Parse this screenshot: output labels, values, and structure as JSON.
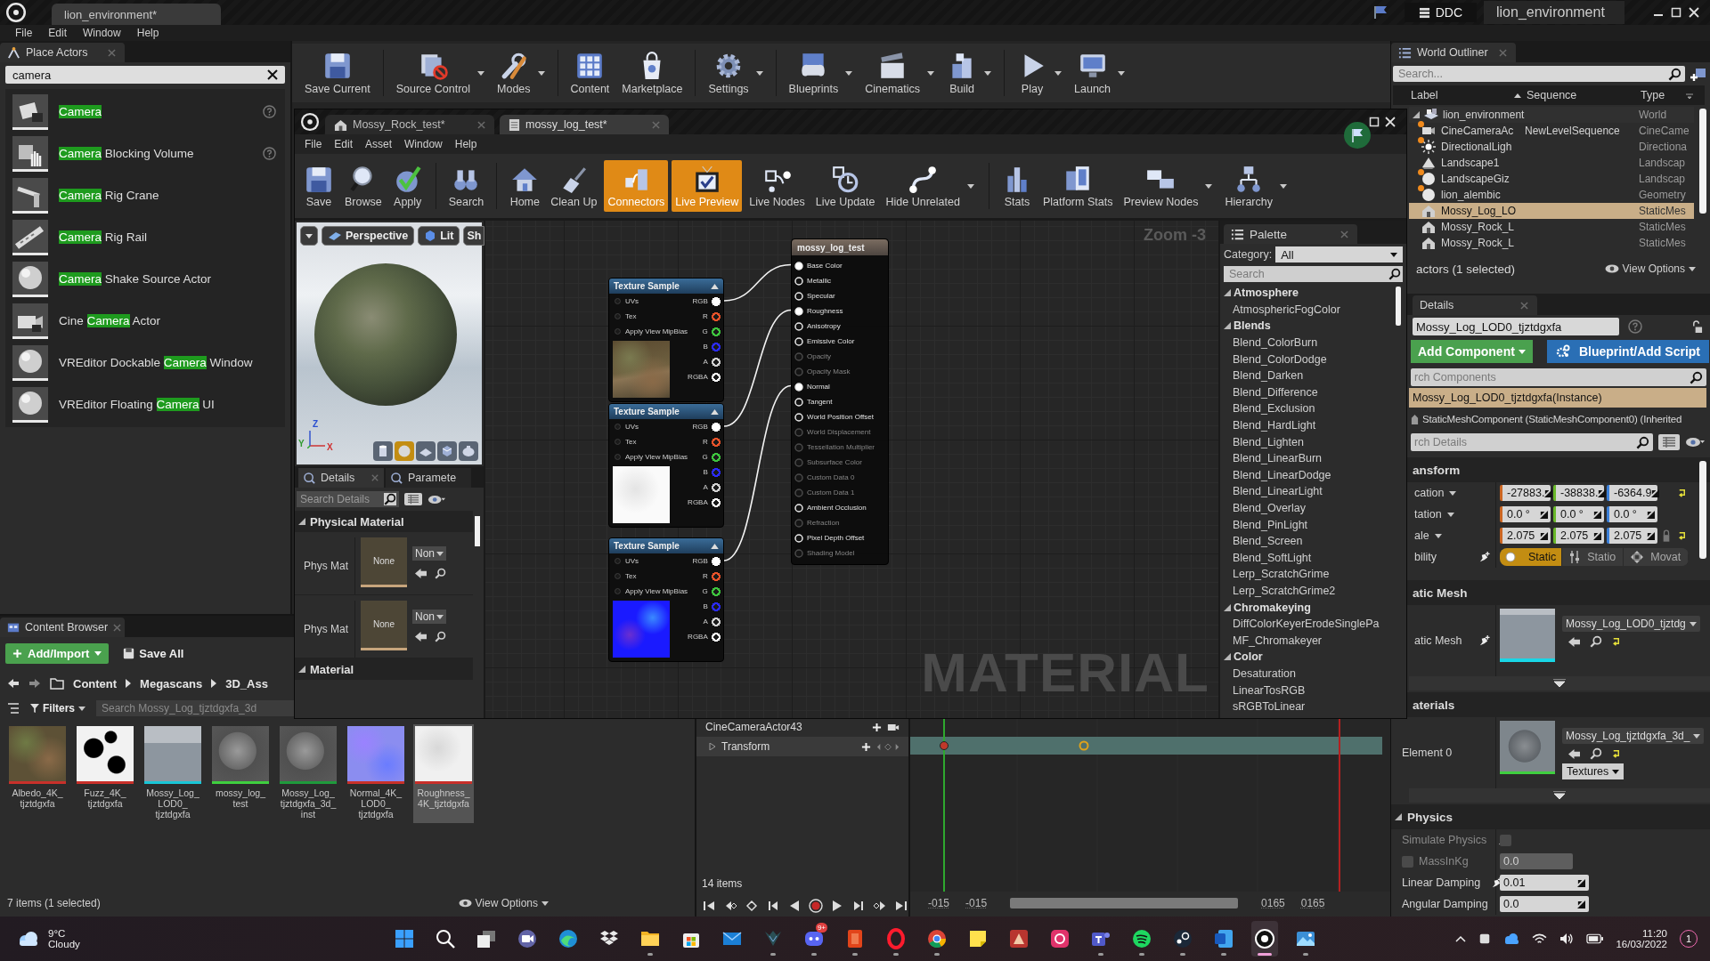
{
  "title_bar": {
    "tab": "lion_environment*",
    "cache": "DDC",
    "project": "lion_environment"
  },
  "menu": [
    "File",
    "Edit",
    "Window",
    "Help"
  ],
  "place_actors": {
    "tab": "Place Actors",
    "search": "camera",
    "items": [
      {
        "match": "Camera",
        "help": true
      },
      {
        "match": "Camera",
        "after": " Blocking Volume",
        "help": true
      },
      {
        "match": "Camera",
        "after": " Rig Crane",
        "help": false
      },
      {
        "match": "Camera",
        "after": " Rig Rail",
        "help": false
      },
      {
        "match": "Camera",
        "after": " Shake Source Actor",
        "help": false
      },
      {
        "before": "Cine ",
        "match": "Camera",
        "after": " Actor",
        "help": false
      },
      {
        "before": "VREditor Dockable ",
        "match": "Camera",
        "after": " Window",
        "help": false
      },
      {
        "before": "VREditor Floating ",
        "match": "Camera",
        "after": " UI",
        "help": false
      }
    ]
  },
  "toolbar": [
    {
      "label": "Save Current",
      "dropdown": false
    },
    {
      "label": "Source Control",
      "dropdown": true
    },
    {
      "label": "Modes",
      "dropdown": true
    },
    {
      "label": "Content",
      "dropdown": false
    },
    {
      "label": "Marketplace",
      "dropdown": false
    },
    {
      "label": "Settings",
      "dropdown": true
    },
    {
      "label": "Blueprints",
      "dropdown": true
    },
    {
      "label": "Cinematics",
      "dropdown": true
    },
    {
      "label": "Build",
      "dropdown": true
    },
    {
      "label": "Play",
      "dropdown": true
    },
    {
      "label": "Launch",
      "dropdown": true
    }
  ],
  "material_editor": {
    "tabs": [
      {
        "label": "Mossy_Rock_test*",
        "selected": false
      },
      {
        "label": "mossy_log_test*",
        "selected": true
      }
    ],
    "menu": [
      "File",
      "Edit",
      "Asset",
      "Window",
      "Help"
    ],
    "toolbar": [
      {
        "label": "Save",
        "on": false,
        "dropdown": false
      },
      {
        "label": "Browse",
        "on": false,
        "dropdown": false
      },
      {
        "label": "Apply",
        "on": false,
        "dropdown": false
      },
      {
        "label": "Search",
        "on": false,
        "dropdown": false
      },
      {
        "label": "Home",
        "on": false,
        "dropdown": false
      },
      {
        "label": "Clean Up",
        "on": false,
        "dropdown": false
      },
      {
        "label": "Connectors",
        "on": true,
        "dropdown": false
      },
      {
        "label": "Live Preview",
        "on": true,
        "dropdown": false
      },
      {
        "label": "Live Nodes",
        "on": false,
        "dropdown": false
      },
      {
        "label": "Live Update",
        "on": false,
        "dropdown": false
      },
      {
        "label": "Hide Unrelated",
        "on": false,
        "dropdown": true
      },
      {
        "label": "Stats",
        "on": false,
        "dropdown": false
      },
      {
        "label": "Platform Stats",
        "on": false,
        "dropdown": false
      },
      {
        "label": "Preview Nodes",
        "on": false,
        "dropdown": true
      },
      {
        "label": "Hierarchy",
        "on": false,
        "dropdown": true
      }
    ],
    "viewport": {
      "view": "Perspective",
      "lighting": "Lit",
      "show": "Sh",
      "axis_labels": [
        "Z",
        "Y",
        "X"
      ],
      "shapes": [
        {
          "selected": false
        },
        {
          "selected": true
        },
        {
          "selected": false
        },
        {
          "selected": false
        },
        {
          "selected": false
        }
      ]
    },
    "details": {
      "tabs": [
        {
          "label": "Details",
          "selected": true
        },
        {
          "label": "Paramete",
          "selected": false
        }
      ],
      "search": {
        "placeholder": "Search Details"
      },
      "sections": [
        {
          "title": "Physical Material",
          "expanded": true,
          "rows": [
            {
              "label": "Phys Mat",
              "thumb": "None",
              "value": "Non"
            },
            {
              "label": "Phys Mat",
              "thumb": "None",
              "value": "Non"
            }
          ]
        },
        {
          "title": "Material",
          "expanded": true
        }
      ]
    },
    "graph": {
      "zoom": "Zoom -3",
      "label": "MATERIAL"
    },
    "texture_nodes": [
      {
        "title": "Texture Sample",
        "inputs": [
          "UVs",
          "Tex",
          "Apply View MipBias"
        ],
        "outputs": [
          {
            "label": "RGB",
            "color": "#ffffff",
            "connected": true
          },
          {
            "label": "R",
            "color": "#e8532a",
            "connected": false
          },
          {
            "label": "G",
            "color": "#3ec43e",
            "connected": false
          },
          {
            "label": "B",
            "color": "#2b2bff",
            "connected": false
          },
          {
            "label": "A",
            "color": "#d0d0d0",
            "connected": false
          },
          {
            "label": "RGBA",
            "color": "#ffffff",
            "connected": false
          }
        ]
      },
      {
        "title": "Texture Sample",
        "inputs": [
          "UVs",
          "Tex",
          "Apply View MipBias"
        ],
        "outputs": [
          {
            "label": "RGB",
            "color": "#ffffff",
            "connected": true
          },
          {
            "label": "R",
            "color": "#e8532a",
            "connected": false
          },
          {
            "label": "G",
            "color": "#3ec43e",
            "connected": false
          },
          {
            "label": "B",
            "color": "#2b2bff",
            "connected": false
          },
          {
            "label": "A",
            "color": "#d0d0d0",
            "connected": false
          },
          {
            "label": "RGBA",
            "color": "#ffffff",
            "connected": false
          }
        ]
      },
      {
        "title": "Texture Sample",
        "inputs": [
          "UVs",
          "Tex",
          "Apply View MipBias"
        ],
        "outputs": [
          {
            "label": "RGB",
            "color": "#ffffff",
            "connected": true
          },
          {
            "label": "R",
            "color": "#e8532a",
            "connected": false
          },
          {
            "label": "G",
            "color": "#3ec43e",
            "connected": false
          },
          {
            "label": "B",
            "color": "#2b2bff",
            "connected": false
          },
          {
            "label": "A",
            "color": "#d0d0d0",
            "connected": false
          },
          {
            "label": "RGBA",
            "color": "#ffffff",
            "connected": false
          }
        ]
      }
    ],
    "output_node": {
      "title": "mossy_log_test",
      "pins": [
        {
          "label": "Base Color",
          "connected": true,
          "disabled": false
        },
        {
          "label": "Metallic",
          "connected": false,
          "disabled": false
        },
        {
          "label": "Specular",
          "connected": false,
          "disabled": false
        },
        {
          "label": "Roughness",
          "connected": true,
          "disabled": false
        },
        {
          "label": "Anisotropy",
          "connected": false,
          "disabled": false
        },
        {
          "label": "Emissive Color",
          "connected": false,
          "disabled": false
        },
        {
          "label": "Opacity",
          "connected": false,
          "disabled": true
        },
        {
          "label": "Opacity Mask",
          "connected": false,
          "disabled": true
        },
        {
          "label": "Normal",
          "connected": true,
          "disabled": false
        },
        {
          "label": "Tangent",
          "connected": false,
          "disabled": false
        },
        {
          "label": "World Position Offset",
          "connected": false,
          "disabled": false
        },
        {
          "label": "World Displacement",
          "connected": false,
          "disabled": true
        },
        {
          "label": "Tessellation Multiplier",
          "connected": false,
          "disabled": true
        },
        {
          "label": "Subsurface Color",
          "connected": false,
          "disabled": true
        },
        {
          "label": "Custom Data 0",
          "connected": false,
          "disabled": true
        },
        {
          "label": "Custom Data 1",
          "connected": false,
          "disabled": true
        },
        {
          "label": "Ambient Occlusion",
          "connected": false,
          "disabled": false
        },
        {
          "label": "Refraction",
          "connected": false,
          "disabled": true
        },
        {
          "label": "Pixel Depth Offset",
          "connected": false,
          "disabled": false
        },
        {
          "label": "Shading Model",
          "connected": false,
          "disabled": true
        }
      ]
    },
    "palette": {
      "tab": "Palette",
      "category_label": "Category:",
      "category": "All",
      "search": {
        "placeholder": "Search"
      },
      "groups": [
        {
          "label": "Atmosphere",
          "expanded": true,
          "children": [
            {
              "label": "AtmosphericFogColor"
            }
          ]
        },
        {
          "label": "Blends",
          "expanded": true,
          "children": [
            {
              "label": "Blend_ColorBurn"
            },
            {
              "label": "Blend_ColorDodge"
            },
            {
              "label": "Blend_Darken"
            },
            {
              "label": "Blend_Difference"
            },
            {
              "label": "Blend_Exclusion"
            },
            {
              "label": "Blend_HardLight"
            },
            {
              "label": "Blend_Lighten"
            },
            {
              "label": "Blend_LinearBurn"
            },
            {
              "label": "Blend_LinearDodge"
            },
            {
              "label": "Blend_LinearLight"
            },
            {
              "label": "Blend_Overlay"
            },
            {
              "label": "Blend_PinLight"
            },
            {
              "label": "Blend_Screen"
            },
            {
              "label": "Blend_SoftLight"
            },
            {
              "label": "Lerp_ScratchGrime"
            },
            {
              "label": "Lerp_ScratchGrime2"
            }
          ]
        },
        {
          "label": "Chromakeying",
          "expanded": true,
          "children": [
            {
              "label": "DiffColorKeyerErodeSinglePa"
            },
            {
              "label": "MF_Chromakeyer"
            }
          ]
        },
        {
          "label": "Color",
          "expanded": true,
          "children": [
            {
              "label": "Desaturation"
            },
            {
              "label": "LinearTosRGB"
            },
            {
              "label": "sRGBToLinear"
            }
          ]
        }
      ]
    }
  },
  "world_outliner": {
    "tab": "World Outliner",
    "search": {
      "placeholder": "Search..."
    },
    "columns": [
      "Label",
      "Sequence",
      "Type"
    ],
    "rows": [
      {
        "label": "lion_environment",
        "type": "World",
        "selected": false,
        "marked": false,
        "expanded": true,
        "children": [
          {
            "label": "CineCameraAc",
            "sequence": "NewLevelSequence",
            "type": "CineCame",
            "selected": false,
            "marked": true
          },
          {
            "label": "DirectionalLigh",
            "type": "Directiona",
            "selected": false,
            "marked": true
          },
          {
            "label": "Landscape1",
            "type": "Landscap",
            "selected": false,
            "marked": false
          },
          {
            "label": "LandscapeGiz",
            "type": "Landscap",
            "selected": false,
            "marked": true
          },
          {
            "label": "lion_alembic",
            "type": "Geometry",
            "selected": false,
            "marked": true
          },
          {
            "label": "Mossy_Log_LO",
            "type": "StaticMes",
            "selected": true,
            "marked": false
          },
          {
            "label": "Mossy_Rock_L",
            "type": "StaticMes",
            "selected": false,
            "marked": false
          },
          {
            "label": "Mossy_Rock_L",
            "type": "StaticMes",
            "selected": false,
            "marked": false
          }
        ]
      }
    ],
    "footer": "actors (1 selected)",
    "view_options": "View Options"
  },
  "details": {
    "tab": "Details",
    "name": "Mossy_Log_LOD0_tjztdgxfa",
    "add_component": "Add Component",
    "blueprint": "Blueprint/Add Script",
    "component_search": {
      "placeholder": "rch Components"
    },
    "components": [
      {
        "label": "Mossy_Log_LOD0_tjztdgxfa(Instance)",
        "selected": true
      },
      {
        "label": "StaticMeshComponent (StaticMeshComponent0) (Inherited",
        "selected": false
      }
    ],
    "detail_search": {
      "placeholder": "rch Details"
    },
    "transform": {
      "title": "ansform",
      "rows": [
        {
          "label": "cation",
          "values": [
            "-27883.",
            "-38838.",
            "-6364.9"
          ],
          "lock": false,
          "reset": true
        },
        {
          "label": "tation",
          "values": [
            "0.0 °",
            "0.0 °",
            "0.0 °"
          ],
          "lock": false,
          "reset": false
        },
        {
          "label": "ale",
          "values": [
            "2.075",
            "2.075",
            "2.075"
          ],
          "lock": true,
          "reset": true
        }
      ],
      "mobility": {
        "label": "bility",
        "options": [
          {
            "label": "Static",
            "selected": true
          },
          {
            "label": "Statio",
            "selected": false
          },
          {
            "label": "Movat",
            "selected": false
          }
        ]
      }
    },
    "static_mesh": {
      "title": "atic Mesh",
      "label": "atic Mesh",
      "asset": "Mossy_Log_LOD0_tjztdg"
    },
    "materials": {
      "title": "aterials",
      "label": "Element 0",
      "asset": "Mossy_Log_tjztdgxfa_3d_",
      "button": "Textures"
    },
    "physics": {
      "title": "Physics",
      "expanded": true,
      "rows": [
        {
          "kind": "checkbox",
          "label": "Simulate Physics",
          "checked": false,
          "disabled": true
        },
        {
          "kind": "mass",
          "label": "MassInKg",
          "checked": false,
          "value": "0.0",
          "disabled": true
        },
        {
          "kind": "number",
          "label": "Linear Damping",
          "value": "0.01",
          "disabled": false
        },
        {
          "kind": "number",
          "label": "Angular Damping",
          "value": "0.0",
          "disabled": false
        }
      ]
    }
  },
  "content_browser": {
    "tab": "Content Browser",
    "add_import": "Add/Import",
    "save_all": "Save All",
    "path": [
      "Content",
      "Megascans",
      "3D_Ass"
    ],
    "filters": "Filters",
    "search": {
      "placeholder": "Search Mossy_Log_tjztdgxfa_3d"
    },
    "assets": [
      {
        "name": "Albedo_4K_tjztdgxfa",
        "color": "#c8302a",
        "selected": false
      },
      {
        "name": "Fuzz_4K_tjztdgxfa",
        "color": "#c8302a",
        "selected": false
      },
      {
        "name": "Mossy_Log_LOD0_tjztdgxfa",
        "color": "#19c6d6",
        "selected": false
      },
      {
        "name": "mossy_log_test",
        "color": "#3fcf3f",
        "selected": false
      },
      {
        "name": "Mossy_Log_tjztdgxfa_3d_inst",
        "color": "#1f9a3c",
        "selected": false
      },
      {
        "name": "Normal_4K_LOD0_tjztdgxfa",
        "color": "#c8302a",
        "selected": false
      },
      {
        "name": "Roughness_4K_tjztdgxfa",
        "color": "#c8302a",
        "selected": true
      }
    ],
    "status": "7 items (1 selected)",
    "view_options": "View Options"
  },
  "sequencer": {
    "actor_track": "CineCameraActor43",
    "transform_track": {
      "label": "Transform",
      "expanded": false
    },
    "count": "14 items",
    "times": [
      "-015",
      "-015",
      "0165",
      "0165"
    ]
  },
  "taskbar": {
    "weather": {
      "temp": "9°C",
      "condition": "Cloudy"
    },
    "apps": [
      {
        "running": false,
        "active": false
      },
      {
        "running": false,
        "active": false
      },
      {
        "running": false,
        "active": false
      },
      {
        "running": false,
        "active": false
      },
      {
        "running": false,
        "active": false
      },
      {
        "running": false,
        "active": false
      },
      {
        "running": true,
        "active": false
      },
      {
        "running": false,
        "active": false
      },
      {
        "running": false,
        "active": false
      },
      {
        "running": true,
        "active": false
      },
      {
        "running": true,
        "active": false,
        "badge": "9+"
      },
      {
        "running": true,
        "active": false
      },
      {
        "running": true,
        "active": false
      },
      {
        "running": true,
        "active": false
      },
      {
        "running": false,
        "active": false
      },
      {
        "running": false,
        "active": false
      },
      {
        "running": false,
        "active": false
      },
      {
        "running": true,
        "active": false
      },
      {
        "running": true,
        "active": false
      },
      {
        "running": true,
        "active": false
      },
      {
        "running": true,
        "active": false
      },
      {
        "running": true,
        "active": true
      },
      {
        "running": true,
        "active": false
      }
    ],
    "time": "11:20",
    "date": "16/03/2022",
    "notifications": "1"
  }
}
